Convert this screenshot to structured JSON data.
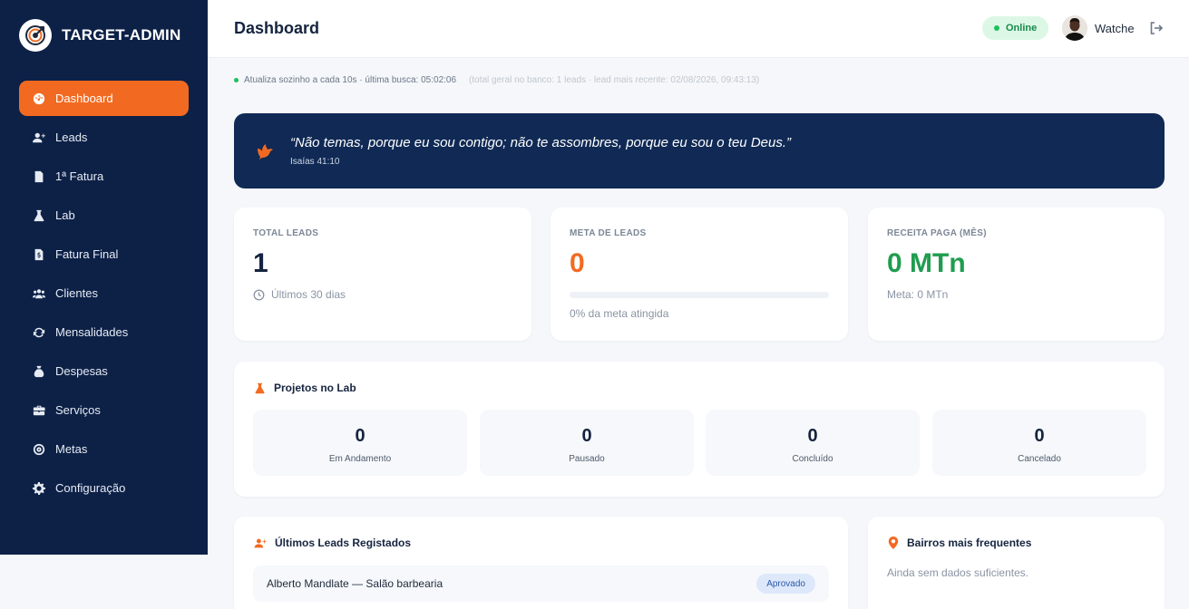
{
  "app": {
    "name": "TARGET-ADMIN"
  },
  "sidebar": {
    "items": [
      {
        "label": "Dashboard",
        "icon": "dashboard-icon",
        "active": true
      },
      {
        "label": "Leads",
        "icon": "user-plus-icon"
      },
      {
        "label": "1ª Fatura",
        "icon": "invoice-icon"
      },
      {
        "label": "Lab",
        "icon": "flask-icon"
      },
      {
        "label": "Fatura Final",
        "icon": "invoice-dollar-icon"
      },
      {
        "label": "Clientes",
        "icon": "users-icon"
      },
      {
        "label": "Mensalidades",
        "icon": "refresh-icon"
      },
      {
        "label": "Despesas",
        "icon": "money-bag-icon"
      },
      {
        "label": "Serviços",
        "icon": "briefcase-icon"
      },
      {
        "label": "Metas",
        "icon": "target-icon"
      },
      {
        "label": "Configuração",
        "icon": "gear-icon"
      }
    ]
  },
  "header": {
    "title": "Dashboard",
    "status": "Online",
    "user_name": "Watche"
  },
  "updates": {
    "text": "Atualiza sozinho a cada 10s · última busca: 05:02:06",
    "meta": "(total geral no banco: 1 leads · lead mais recente: 02/08/2026, 09:43:13)"
  },
  "verse": {
    "text": "“Não temas, porque eu sou contigo; não te assombres, porque eu sou o teu Deus.”",
    "reference": "Isaías 41:10"
  },
  "stats": {
    "leads": {
      "label": "TOTAL LEADS",
      "value": "1",
      "sub": "Últimos 30 dias"
    },
    "goal": {
      "label": "META DE LEADS",
      "value": "0",
      "progress_percent": 0,
      "sub": "0% da meta atingida"
    },
    "revenue": {
      "label": "RECEITA PAGA (MÊS)",
      "value": "0 MTn",
      "sub": "Meta: 0 MTn"
    }
  },
  "lab": {
    "title": "Projetos no Lab",
    "items": [
      {
        "value": "0",
        "label": "Em Andamento"
      },
      {
        "value": "0",
        "label": "Pausado"
      },
      {
        "value": "0",
        "label": "Concluído"
      },
      {
        "value": "0",
        "label": "Cancelado"
      }
    ]
  },
  "leads_list": {
    "title": "Últimos Leads Registados",
    "rows": [
      {
        "name": "Alberto Mandlate — Salão barbearia",
        "status": "Aprovado"
      }
    ]
  },
  "neighborhoods": {
    "title": "Bairros mais frequentes",
    "empty": "Ainda sem dados suficientes."
  },
  "colors": {
    "sidebar": "#0d2147",
    "accent": "#f26a21",
    "success": "#1f9d4f",
    "banner": "#102a55"
  }
}
